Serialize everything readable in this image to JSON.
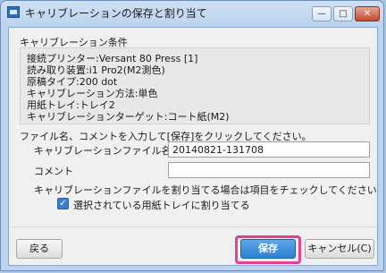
{
  "window": {
    "title": "キャリブレーションの保存と割り当て",
    "minimize_symbol": "—",
    "maximize_symbol": "□",
    "close_symbol": "✕"
  },
  "conditions": {
    "heading": "キャリブレーション条件",
    "lines": [
      "接続プリンター:Versant 80 Press [1]",
      "読み取り装置:i1 Pro2(M2測色)",
      "原稿タイプ:200 dot",
      "キャリブレーション方法:単色",
      "用紙トレイ:トレイ2",
      "キャリブレーションターゲット:コート紙(M2)"
    ]
  },
  "form": {
    "instruction": "ファイル名、コメントを入力して[保存]をクリックしてください。",
    "filename_label": "キャリブレーションファイル名",
    "filename_value": "20140821-131708",
    "comment_label": "コメント",
    "comment_value": "",
    "assign_note": "キャリブレーションファイルを割り当てる場合は項目をチェックしてください",
    "assign_checkbox_label": "選択されている用紙トレイに割り当てる",
    "assign_checked": true
  },
  "buttons": {
    "back": "戻る",
    "save": "保存",
    "cancel": "キャンセル(C)"
  }
}
